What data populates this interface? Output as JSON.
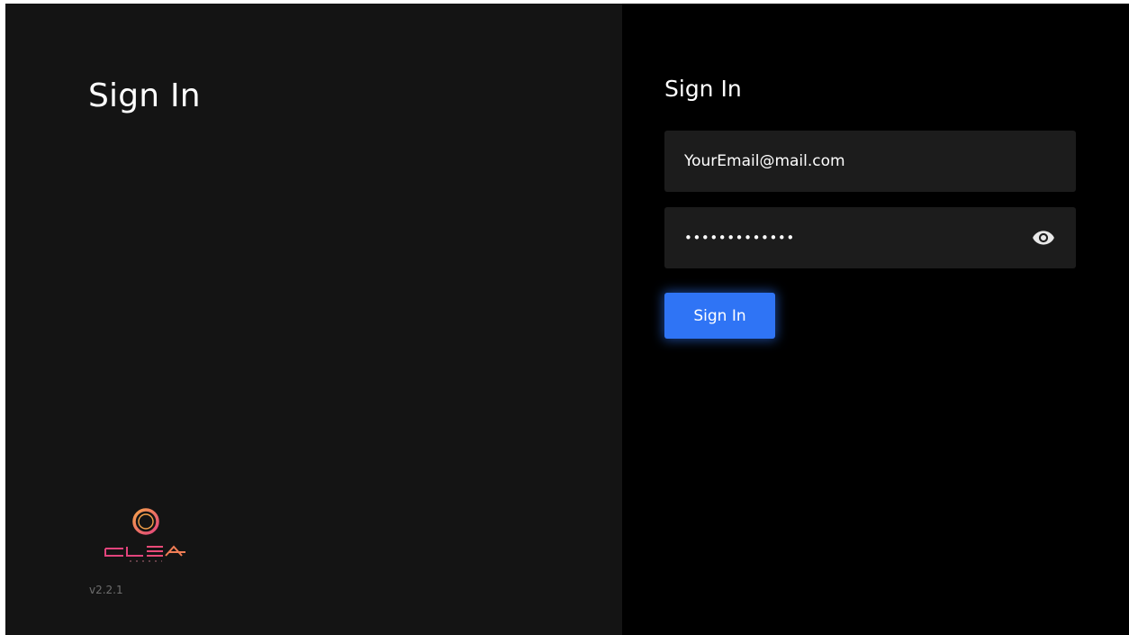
{
  "left_panel": {
    "title": "Sign In",
    "version": "v2.2.1",
    "logo_icon": "clearfront-logo-icon"
  },
  "form": {
    "title": "Sign In",
    "email": {
      "value": "YourEmail@mail.com"
    },
    "password": {
      "masked_value": "•••••••••••••",
      "toggle_icon": "eye-icon"
    },
    "submit_label": "Sign In"
  },
  "colors": {
    "left_background": "#141414",
    "right_background": "#000000",
    "field_background": "#1c1c1c",
    "accent": "#2f74f5",
    "text": "#ffffff",
    "muted_text": "#6e6e6e"
  }
}
